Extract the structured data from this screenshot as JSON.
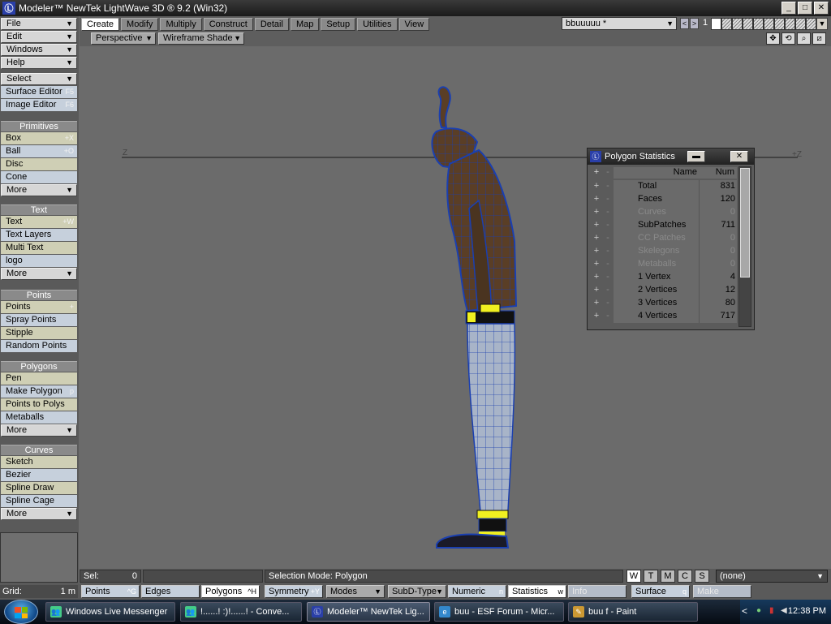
{
  "window": {
    "title": "Modeler™ NewTek LightWave 3D ® 9.2 (Win32)",
    "app_icon": "Ⓛ",
    "controls": {
      "minimize": "_",
      "maximize": "□",
      "close": "✕"
    }
  },
  "tabs": [
    "Create",
    "Modify",
    "Multiply",
    "Construct",
    "Detail",
    "Map",
    "Setup",
    "Utilities",
    "View"
  ],
  "active_tab": "Create",
  "layer": {
    "name": "bbuuuuu *",
    "nav_prev": "<",
    "nav_next": ">",
    "number": "1"
  },
  "viewport": {
    "view": "Perspective",
    "shading": "Wireframe Shade",
    "tools": [
      "✥",
      "⟲",
      "⌕",
      "⧄"
    ],
    "axis_left": "Z",
    "axis_right": "+Z"
  },
  "left_toolbar": {
    "menus": [
      "File",
      "Edit",
      "Windows",
      "Help"
    ],
    "select": "Select",
    "surface_editor": {
      "label": "Surface Editor",
      "shortcut": "F5"
    },
    "image_editor": {
      "label": "Image Editor",
      "shortcut": "F6"
    },
    "primitives": {
      "header": "Primitives",
      "items": [
        {
          "label": "Box",
          "shortcut": "+X"
        },
        {
          "label": "Ball",
          "shortcut": "+O"
        },
        {
          "label": "Disc",
          "shortcut": ""
        },
        {
          "label": "Cone",
          "shortcut": ""
        },
        {
          "label": "More",
          "shortcut": ""
        }
      ]
    },
    "text": {
      "header": "Text",
      "items": [
        {
          "label": "Text",
          "shortcut": "+W"
        },
        {
          "label": "Text Layers",
          "shortcut": ""
        },
        {
          "label": "Multi Text",
          "shortcut": ""
        },
        {
          "label": "logo",
          "shortcut": ""
        },
        {
          "label": "More",
          "shortcut": ""
        }
      ]
    },
    "points": {
      "header": "Points",
      "items": [
        {
          "label": "Points",
          "shortcut": "+"
        },
        {
          "label": "Spray Points",
          "shortcut": ""
        },
        {
          "label": "Stipple",
          "shortcut": ""
        },
        {
          "label": "Random Points",
          "shortcut": ""
        }
      ]
    },
    "polygons": {
      "header": "Polygons",
      "items": [
        {
          "label": "Pen",
          "shortcut": ""
        },
        {
          "label": "Make Polygon",
          "shortcut": "p"
        },
        {
          "label": "Points to Polys",
          "shortcut": ""
        },
        {
          "label": "Metaballs",
          "shortcut": ""
        },
        {
          "label": "More",
          "shortcut": ""
        }
      ]
    },
    "curves": {
      "header": "Curves",
      "items": [
        {
          "label": "Sketch",
          "shortcut": ""
        },
        {
          "label": "Bezier",
          "shortcut": ""
        },
        {
          "label": "Spline Draw",
          "shortcut": ""
        },
        {
          "label": "Spline Cage",
          "shortcut": ""
        },
        {
          "label": "More",
          "shortcut": ""
        }
      ]
    }
  },
  "polygon_statistics": {
    "title": "Polygon Statistics",
    "min_btn": "▬",
    "close_btn": "✕",
    "col_plus": "+",
    "col_minus": "-",
    "col_name": "Name",
    "col_num": "Num",
    "rows": [
      {
        "name": "Total",
        "num": "831",
        "dim": false
      },
      {
        "name": "Faces",
        "num": "120",
        "dim": false
      },
      {
        "name": "Curves",
        "num": "0",
        "dim": true
      },
      {
        "name": "SubPatches",
        "num": "711",
        "dim": false
      },
      {
        "name": "CC Patches",
        "num": "0",
        "dim": true
      },
      {
        "name": "Skelegons",
        "num": "0",
        "dim": true
      },
      {
        "name": "Metaballs",
        "num": "0",
        "dim": true
      },
      {
        "name": "1 Vertex",
        "num": "4",
        "dim": false
      },
      {
        "name": "2 Vertices",
        "num": "12",
        "dim": false
      },
      {
        "name": "3 Vertices",
        "num": "80",
        "dim": false
      },
      {
        "name": "4 Vertices",
        "num": "717",
        "dim": false
      }
    ]
  },
  "status": {
    "sel_label": "Sel:",
    "sel_value": "0",
    "selection_mode": "Selection Mode:  Polygon",
    "wtmcs": [
      "W",
      "T",
      "M",
      "C",
      "S"
    ],
    "surface": "(none)"
  },
  "command_bar": {
    "grid_label": "Grid:",
    "grid_value": "1 m",
    "points": {
      "label": "Points",
      "shortcut": "^G"
    },
    "edges": {
      "label": "Edges",
      "shortcut": ""
    },
    "polygons": {
      "label": "Polygons",
      "shortcut": "^H"
    },
    "symmetry": {
      "label": "Symmetry",
      "shortcut": "+Y"
    },
    "modes": "Modes",
    "subd_type": "SubD-Type",
    "numeric": {
      "label": "Numeric",
      "shortcut": "n"
    },
    "statistics": {
      "label": "Statistics",
      "shortcut": "w"
    },
    "info": "Info",
    "surface": {
      "label": "Surface",
      "shortcut": "q"
    },
    "make": "Make"
  },
  "taskbar": {
    "tasks": [
      {
        "label": "Windows Live Messenger",
        "icon": "👥"
      },
      {
        "label": "!......! :)!......! - Conve...",
        "icon": "👥"
      },
      {
        "label": "Modeler™ NewTek Lig...",
        "icon": "Ⓛ"
      },
      {
        "label": "buu - ESF Forum - Micr...",
        "icon": "e"
      },
      {
        "label": "buu f - Paint",
        "icon": "✎"
      }
    ],
    "tray_arrow": "<",
    "clock": "12:38 PM"
  },
  "colors": {
    "viewport_bg": "#6b6b6b",
    "wire": "#1a3fb0",
    "skin": "#5a3e26",
    "belt_yellow": "#f0f020",
    "pants": "#a8b4c8"
  }
}
